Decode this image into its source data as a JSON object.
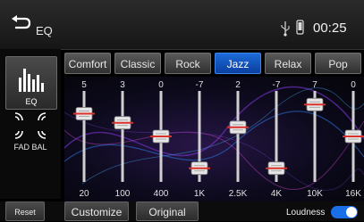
{
  "header": {
    "title": "EQ",
    "time": "00:25"
  },
  "sidebar": {
    "eq_label": "EQ",
    "fadbal_label": "FAD BAL"
  },
  "presets": [
    {
      "label": "Comfort",
      "active": false
    },
    {
      "label": "Classic",
      "active": false
    },
    {
      "label": "Rock",
      "active": false
    },
    {
      "label": "Jazz",
      "active": true
    },
    {
      "label": "Relax",
      "active": false
    },
    {
      "label": "Pop",
      "active": false
    }
  ],
  "eq": {
    "bands": [
      {
        "freq": "20",
        "gain": "5"
      },
      {
        "freq": "100",
        "gain": "3"
      },
      {
        "freq": "400",
        "gain": "0"
      },
      {
        "freq": "1K",
        "gain": "-7"
      },
      {
        "freq": "2.5K",
        "gain": "2"
      },
      {
        "freq": "4K",
        "gain": "-7"
      },
      {
        "freq": "10K",
        "gain": "7"
      },
      {
        "freq": "16K",
        "gain": "0"
      }
    ]
  },
  "bottom": {
    "reset_label": "Reset",
    "customize_label": "Customize",
    "original_label": "Original",
    "loudness_label": "Loudness",
    "loudness_on": true
  },
  "colors": {
    "accent": "#1a6ee6",
    "slider_mark": "#d9322c"
  }
}
